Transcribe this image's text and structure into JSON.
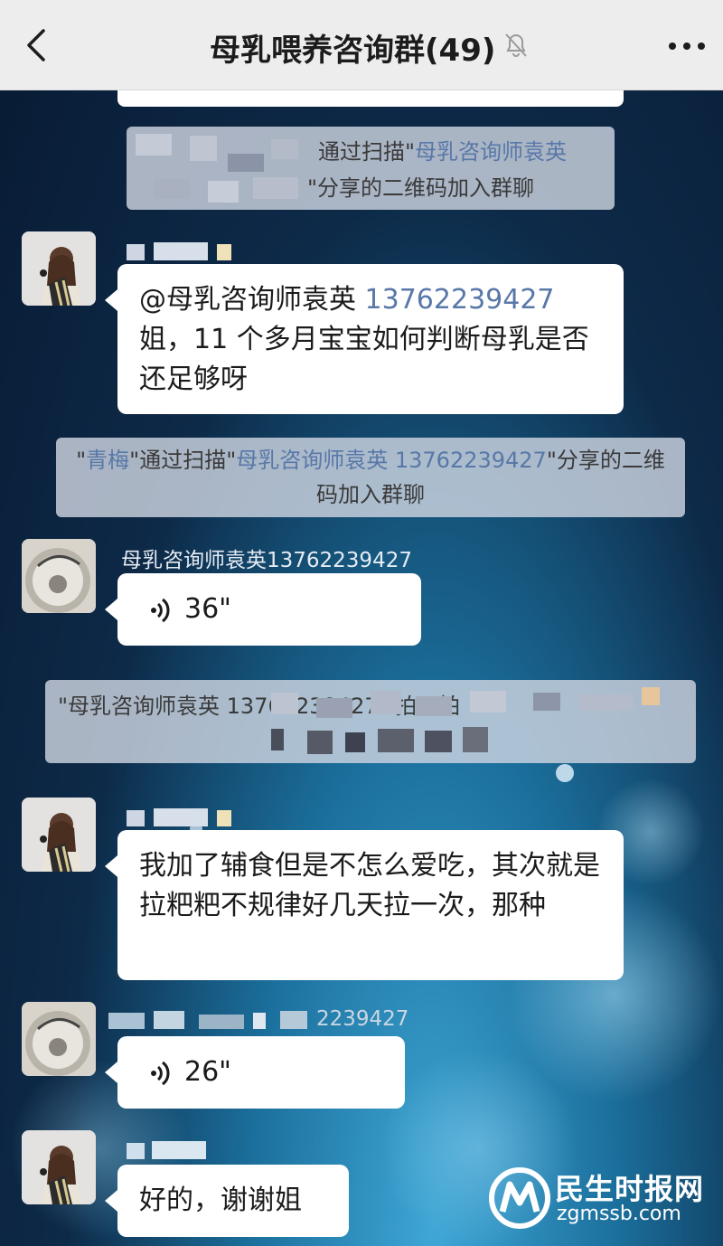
{
  "header": {
    "title": "母乳喂养咨询群(49)",
    "back_icon": "chevron-left-icon",
    "mute_icon": "bell-muted-icon",
    "more_icon": "more-dots-icon"
  },
  "messages": {
    "notice1": {
      "part1": "通过扫描\"",
      "highlight": "母乳咨询师袁英",
      "part2": "\"分享的二维码加入群聊"
    },
    "msg1": {
      "mention": "@母乳咨询师袁英 ",
      "phone": "13762239427",
      "text": "姐，11 个多月宝宝如何判断母乳是否还足够呀"
    },
    "notice2": {
      "q1": "\"",
      "name": "青梅",
      "mid": "\"通过扫描\"",
      "highlight": "母乳咨询师袁英 13762239427",
      "tail": "\"分享的二维码加入群聊"
    },
    "msg2": {
      "sender": "母乳咨询师袁英13762239427",
      "voice": "36\""
    },
    "notice3": {
      "text": "\"母乳咨询师袁英 13762239427\" 拍了拍"
    },
    "msg3": {
      "text": "我加了辅食但是不怎么爱吃，其次就是拉粑粑不规律好几天拉一次，那种"
    },
    "msg4": {
      "sender_fragment": "2239427",
      "voice": "26\""
    },
    "msg5": {
      "text": "好的，谢谢姐"
    }
  },
  "watermark": {
    "name": "民生时报网",
    "url": "zgmssb.com"
  }
}
